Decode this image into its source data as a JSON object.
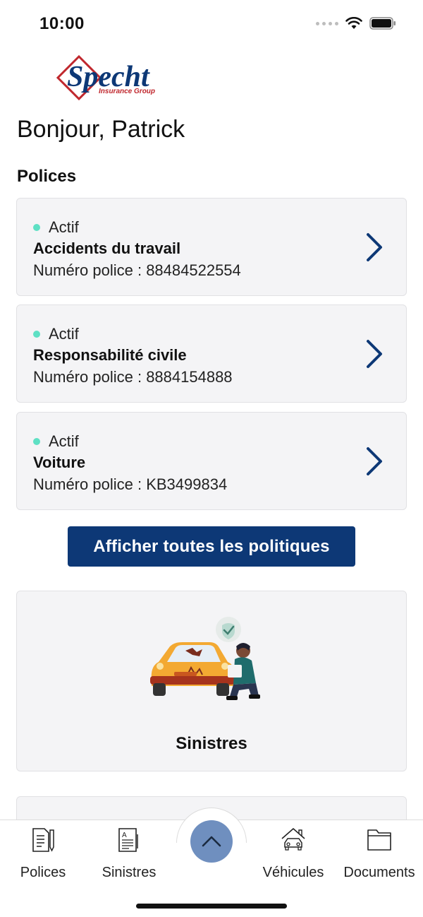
{
  "status_bar": {
    "time": "10:00"
  },
  "brand": {
    "logo_text": "Specht",
    "logo_subtext": "Insurance Group",
    "primary_color": "#0d3876",
    "accent_color": "#c0272d"
  },
  "greeting": "Bonjour, Patrick",
  "policies_section": {
    "title": "Polices",
    "items": [
      {
        "status": "Actif",
        "name": "Accidents du travail",
        "number_label": "Numéro police : ",
        "number": "88484522554"
      },
      {
        "status": "Actif",
        "name": "Responsabilité civile",
        "number_label": "Numéro police : ",
        "number": "8884154888"
      },
      {
        "status": "Actif",
        "name": "Voiture",
        "number_label": "Numéro police : ",
        "number": "KB3499834"
      }
    ],
    "status_color": "#5ee0c4"
  },
  "view_all_button": {
    "label": "Afficher toutes les politiques"
  },
  "claims_card": {
    "label": "Sinistres",
    "illustration": "car-claim-illustration"
  },
  "tab_bar": {
    "items": [
      {
        "label": "Polices",
        "icon": "policy-document-icon"
      },
      {
        "label": "Sinistres",
        "icon": "claims-document-icon"
      },
      {
        "label": "Véhicules",
        "icon": "car-garage-icon"
      },
      {
        "label": "Documents",
        "icon": "folder-icon"
      }
    ],
    "fab_icon": "chevron-up-icon"
  }
}
